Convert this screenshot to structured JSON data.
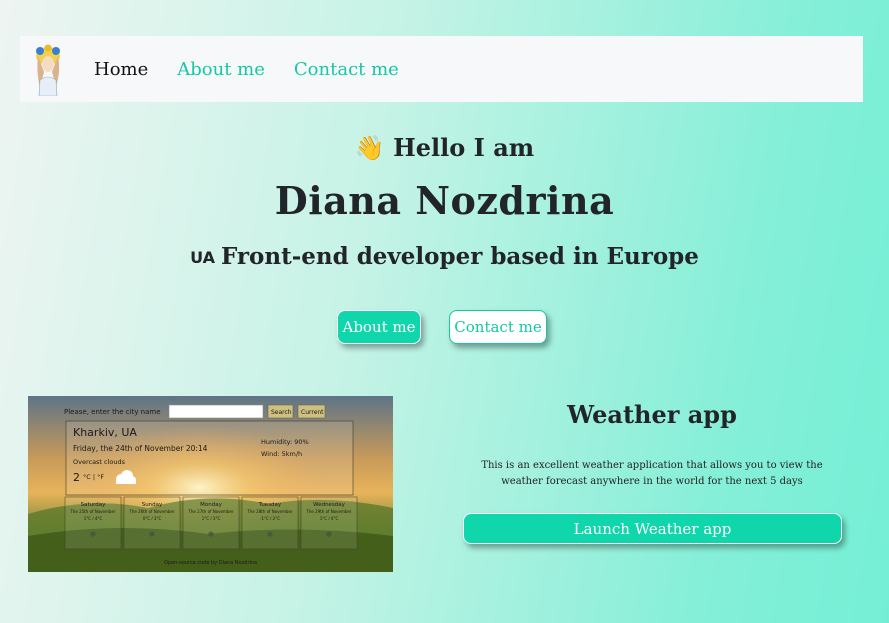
{
  "nav": {
    "items": [
      {
        "label": "Home"
      },
      {
        "label": "About me"
      },
      {
        "label": "Contact me"
      }
    ]
  },
  "hero": {
    "greeting": "Hello I am",
    "greeting_emoji": "👋",
    "name": "Diana Nozdrina",
    "flag": "UA",
    "tagline": "Front-end developer based in Europe"
  },
  "buttons": {
    "about": "About me",
    "contact": "Contact me"
  },
  "project": {
    "title": "Weather app",
    "description": "This is an excellent weather application that allows you to view the weather forecast anywhere in the world for the next 5 days",
    "button": "Launch Weather app"
  },
  "weather_preview": {
    "search_label": "Please, enter the city name",
    "search_button": "Search",
    "current_button": "Current",
    "city": "Kharkiv, UA",
    "date": "Friday, the 24th of November 20:14",
    "description": "Overcast clouds",
    "temperature": "2",
    "units": "°C | °F",
    "humidity": "Humidity: 90%",
    "wind": "Wind: 5km/h",
    "days": [
      {
        "name": "Saturday",
        "date": "The 25th of November",
        "temp": "1°C / 4°C"
      },
      {
        "name": "Sunday",
        "date": "The 26th of November",
        "temp": "0°C / 3°C"
      },
      {
        "name": "Monday",
        "date": "The 27th of November",
        "temp": "1°C / 3°C"
      },
      {
        "name": "Tuesday",
        "date": "The 28th of November",
        "temp": "-1°C / 2°C"
      },
      {
        "name": "Wednesday",
        "date": "The 29th of November",
        "temp": "1°C / 4°C"
      }
    ],
    "footer": "Open-source code by Diana Nozdrina"
  },
  "colors": {
    "accent": "#0fd7ab",
    "nav_background": "#f7f8fa"
  }
}
